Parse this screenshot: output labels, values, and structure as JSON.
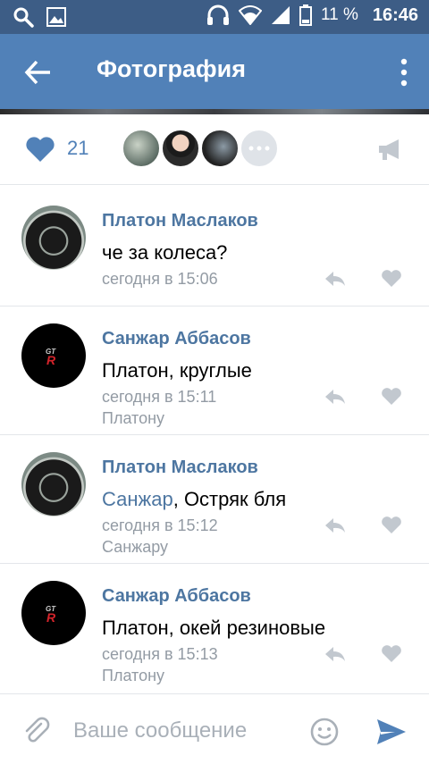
{
  "status_bar": {
    "battery": "11 %",
    "time": "16:46",
    "icons": [
      "search-icon",
      "image-icon",
      "headphones-icon",
      "wifi-icon",
      "signal-icon",
      "battery-icon"
    ]
  },
  "header": {
    "title": "Фотография",
    "icons": [
      "back-arrow-icon",
      "more-vertical-icon"
    ]
  },
  "photo_actions": {
    "likes_count": "21",
    "icons": [
      "heart-icon",
      "more-horizontal-icon",
      "megaphone-icon"
    ]
  },
  "comments": [
    {
      "author": "Платон Маслаков",
      "mention": "",
      "text": "че за колеса?",
      "time": "сегодня в 15:06",
      "reply_to": ""
    },
    {
      "author": "Санжар Аббасов",
      "mention": "",
      "text": "Платон, круглые",
      "time": "сегодня в 15:11",
      "reply_to": "Платону"
    },
    {
      "author": "Платон Маслаков",
      "mention": "Санжар",
      "text": ", Остряк бля",
      "time": "сегодня в 15:12",
      "reply_to": "Санжару"
    },
    {
      "author": "Санжар Аббасов",
      "mention": "",
      "text": "Платон, окей резиновые",
      "time": "сегодня в 15:13",
      "reply_to": "Платону"
    }
  ],
  "composer": {
    "placeholder": "Ваше сообщение",
    "value": "",
    "icons": [
      "paperclip-icon",
      "emoji-icon",
      "send-icon"
    ]
  },
  "colors": {
    "status_bar": "#3d5d86",
    "app_bar": "#5181b8",
    "link": "#4d76a1",
    "meta": "#939ba4",
    "icon_grey": "#c2c8cf"
  }
}
